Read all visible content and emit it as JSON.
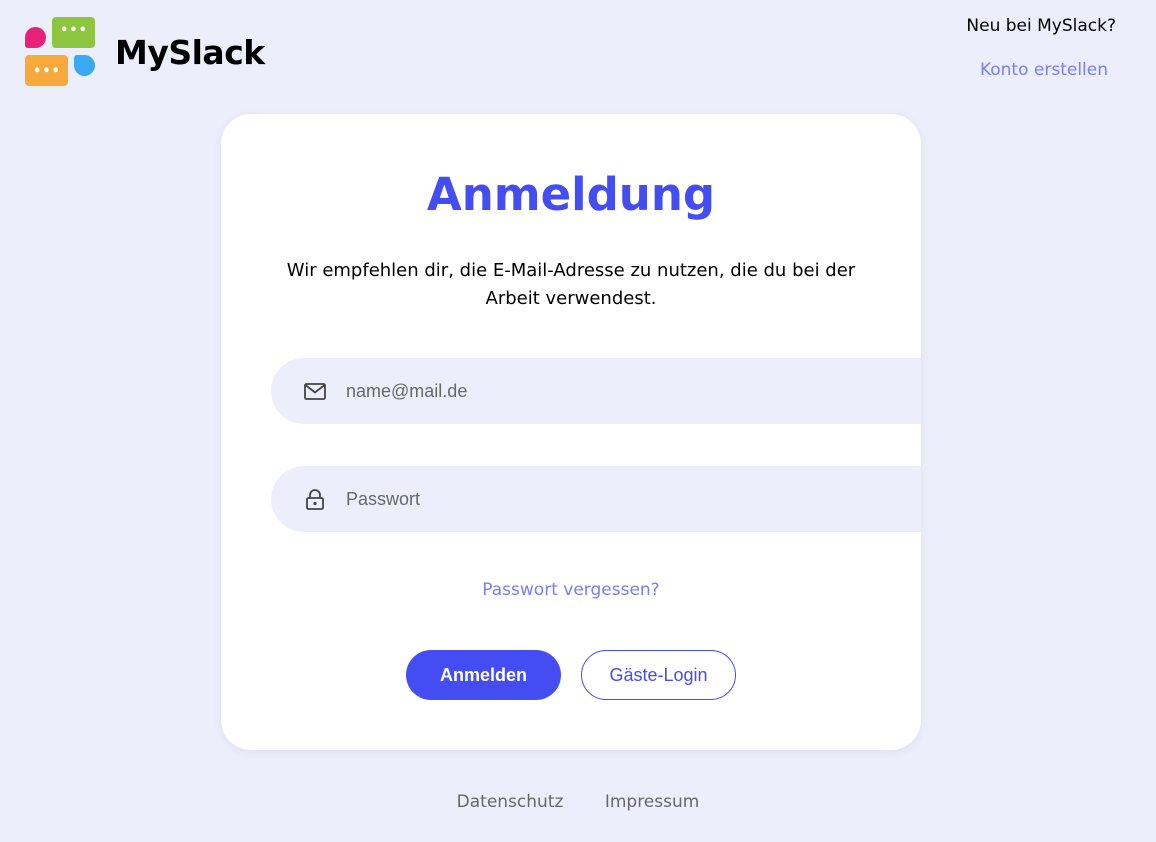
{
  "brand": {
    "name": "MySlack"
  },
  "header": {
    "signup_prompt": "Neu bei MySlack?",
    "signup_link": "Konto erstellen"
  },
  "login": {
    "title": "Anmeldung",
    "description": "Wir empfehlen dir, die E-Mail-Adresse zu nutzen, die du bei der Arbeit verwendest.",
    "email": {
      "placeholder": "name@mail.de",
      "value": ""
    },
    "password": {
      "placeholder": "Passwort",
      "value": ""
    },
    "forgot_link": "Passwort vergessen?",
    "submit_label": "Anmelden",
    "guest_label": "Gäste-Login"
  },
  "footer": {
    "privacy": "Datenschutz",
    "imprint": "Impressum"
  },
  "colors": {
    "background": "#ECEEFB",
    "primary": "#444DF2",
    "link": "#797EF3"
  },
  "icons": {
    "email": "mail-icon",
    "password": "lock-icon"
  }
}
